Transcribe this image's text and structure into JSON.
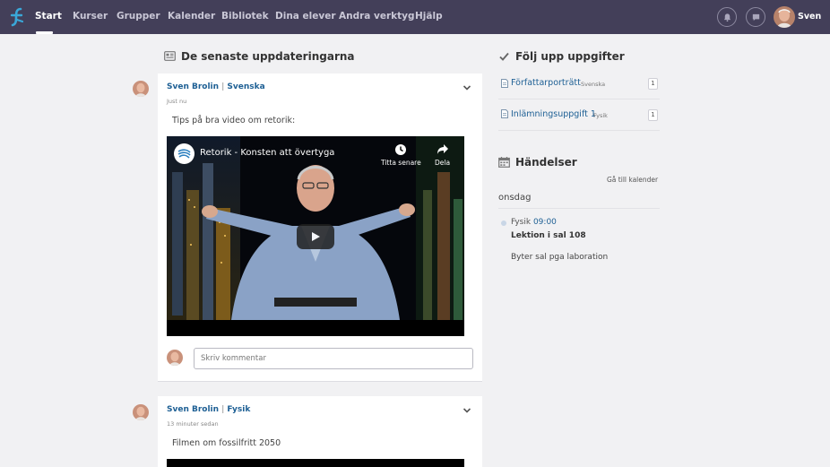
{
  "nav": {
    "items": [
      {
        "label": "Start",
        "active": true
      },
      {
        "label": "Kurser"
      },
      {
        "label": "Grupper"
      },
      {
        "label": "Kalender"
      },
      {
        "label": "Bibliotek"
      },
      {
        "label": "Dina elever"
      },
      {
        "label": "Andra verktyg"
      },
      {
        "label": "Hjälp"
      }
    ],
    "icons": [
      "bell-icon",
      "chat-icon"
    ],
    "user_name": "Sven"
  },
  "feed": {
    "title": "De senaste uppdateringarna",
    "posts": [
      {
        "author": "Sven Brolin",
        "separator": "|",
        "course": "Svenska",
        "time": "Just nu",
        "text": "Tips på bra video om retorik:",
        "video": {
          "title": "Retorik - Konsten att övertyga",
          "watch_later": "Titta senare",
          "share": "Dela"
        },
        "comment_placeholder": "Skriv kommentar"
      },
      {
        "author": "Sven Brolin",
        "separator": "|",
        "course": "Fysik",
        "time": "13 minuter sedan",
        "text": "Filmen om fossilfritt 2050"
      }
    ]
  },
  "tasks": {
    "title": "Följ upp uppgifter",
    "items": [
      {
        "name": "Författarporträtt",
        "course": "Svenska",
        "count": "1"
      },
      {
        "name": "Inlämningsuppgift 1",
        "course": "Fysik",
        "count": "1"
      }
    ]
  },
  "events": {
    "title": "Händelser",
    "calendar_link": "Gå till kalender",
    "day": "onsdag",
    "items": [
      {
        "course": "Fysik",
        "time": "09:00",
        "title": "Lektion i sal 108",
        "note": "Byter sal pga laboration"
      }
    ]
  },
  "colors": {
    "topbar": "#433f59",
    "link": "#1d5f94",
    "background": "#f1f1f3",
    "logo": "#3aa7d8"
  }
}
